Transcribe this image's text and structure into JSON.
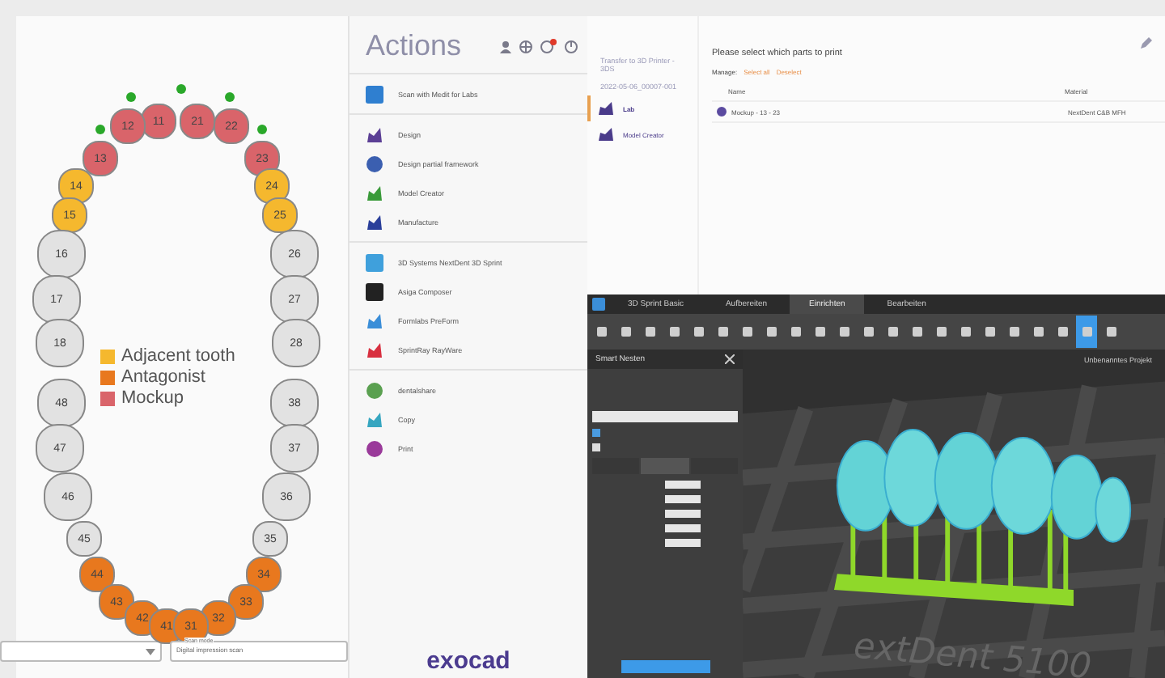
{
  "tooth_chart": {
    "quadrants": [
      {
        "teeth": [
          {
            "number": "11",
            "kind": "mockup",
            "dot": true
          },
          {
            "number": "12",
            "kind": "mockup",
            "dot": true
          },
          {
            "number": "13",
            "kind": "mockup",
            "dot": true
          },
          {
            "number": "14",
            "kind": "adjacent",
            "dot": false
          },
          {
            "number": "15",
            "kind": "adjacent",
            "dot": false
          },
          {
            "number": "16",
            "kind": "none",
            "dot": false
          },
          {
            "number": "17",
            "kind": "none",
            "dot": false
          },
          {
            "number": "18",
            "kind": "none",
            "dot": false
          }
        ]
      },
      {
        "teeth": [
          {
            "number": "21",
            "kind": "mockup",
            "dot": false
          },
          {
            "number": "22",
            "kind": "mockup",
            "dot": true
          },
          {
            "number": "23",
            "kind": "mockup",
            "dot": true
          },
          {
            "number": "24",
            "kind": "adjacent",
            "dot": false
          },
          {
            "number": "25",
            "kind": "adjacent",
            "dot": false
          },
          {
            "number": "26",
            "kind": "none",
            "dot": false
          },
          {
            "number": "27",
            "kind": "none",
            "dot": false
          },
          {
            "number": "28",
            "kind": "none",
            "dot": false
          }
        ]
      },
      {
        "teeth": [
          {
            "number": "48",
            "kind": "none",
            "dot": false
          },
          {
            "number": "47",
            "kind": "none",
            "dot": false
          },
          {
            "number": "46",
            "kind": "none",
            "dot": false
          },
          {
            "number": "45",
            "kind": "none",
            "dot": false
          },
          {
            "number": "44",
            "kind": "antagonist",
            "dot": false
          },
          {
            "number": "43",
            "kind": "antagonist",
            "dot": false
          },
          {
            "number": "42",
            "kind": "antagonist",
            "dot": false
          },
          {
            "number": "41",
            "kind": "antagonist",
            "dot": false
          }
        ]
      },
      {
        "teeth": [
          {
            "number": "38",
            "kind": "none",
            "dot": false
          },
          {
            "number": "37",
            "kind": "none",
            "dot": false
          },
          {
            "number": "36",
            "kind": "none",
            "dot": false
          },
          {
            "number": "35",
            "kind": "none",
            "dot": false
          },
          {
            "number": "34",
            "kind": "antagonist",
            "dot": false
          },
          {
            "number": "33",
            "kind": "antagonist",
            "dot": false
          },
          {
            "number": "32",
            "kind": "antagonist",
            "dot": false
          },
          {
            "number": "31",
            "kind": "antagonist",
            "dot": false
          }
        ]
      }
    ],
    "legend": [
      {
        "label": "Adjacent tooth",
        "kind": "adjacent",
        "color": "#f5b82e"
      },
      {
        "label": "Antagonist",
        "kind": "antagonist",
        "color": "#e8781e"
      },
      {
        "label": "Mockup",
        "kind": "mockup",
        "color": "#d9646a"
      }
    ],
    "scan_mode": {
      "label": "Scan mode",
      "value": "Digital impression scan"
    }
  },
  "actions": {
    "title": "Actions",
    "groups": [
      [
        "Scan with Medit for Labs"
      ],
      [
        "Design",
        "Design partial framework",
        "Model Creator",
        "Manufacture"
      ],
      [
        "3D Systems NextDent 3D Sprint",
        "Asiga Composer",
        "Formlabs PreForm",
        "SprintRay RayWare"
      ],
      [
        "dentalshare",
        "Copy",
        "Print"
      ]
    ],
    "logo": "exocad"
  },
  "transfer": {
    "title": "Transfer to 3D Printer - 3DS",
    "job": "2022-05-06_00007-001",
    "nav": [
      {
        "label": "Lab",
        "selected": true
      },
      {
        "label": "Model Creator",
        "selected": false
      }
    ],
    "prompt": "Please select which parts to print",
    "manage_label": "Manage:",
    "manage_links": [
      "Select all",
      "Deselect"
    ],
    "columns": [
      "Name",
      "Material"
    ],
    "rows": [
      {
        "name": "Mockup - 13 - 23",
        "material": "NextDent C&B MFH",
        "selected": true
      }
    ]
  },
  "sprint": {
    "tabs": [
      {
        "label": "3D Sprint Basic",
        "selected": false
      },
      {
        "label": "Aufbereiten",
        "selected": false
      },
      {
        "label": "Einrichten",
        "selected": true
      },
      {
        "label": "Bearbeiten",
        "selected": false
      }
    ],
    "toolbar": [
      false,
      false,
      false,
      false,
      false,
      false,
      false,
      false,
      false,
      false,
      false,
      false,
      false,
      false,
      false,
      false,
      false,
      false,
      false,
      false,
      true,
      false
    ],
    "panel_title": "Smart Nesten",
    "checkboxes": [
      {
        "checked": true
      },
      {
        "checked": false
      }
    ],
    "panel_tabs": [
      {
        "selected": false
      },
      {
        "selected": true
      },
      {
        "selected": false
      }
    ],
    "project": "Unbenanntes Projekt",
    "printer_label": "extDent 5100"
  }
}
